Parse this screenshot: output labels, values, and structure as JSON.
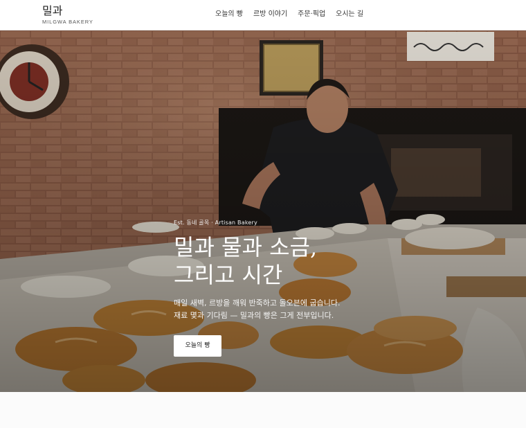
{
  "brand": {
    "title": "밀과",
    "subtitle": "MILGWA BAKERY"
  },
  "nav": {
    "items": [
      "오늘의 빵",
      "르방 이야기",
      "주문·픽업",
      "오시는 길"
    ]
  },
  "hero": {
    "eyebrow": "Est. 동네 골목 · Artisan Bakery",
    "title_line1": "밀과 물과 소금,",
    "title_line2": "그리고 시간",
    "desc_line1": "매일 새벽, 르방을 깨워 반죽하고 돌오븐에 굽습니다.",
    "desc_line2": "재료 몇과 기다림 — 밀과의 빵은 그게 전부입니다.",
    "cta_label": "오늘의 빵"
  },
  "colors": {
    "accent": "#ffffff",
    "text": "#222222",
    "header_bg": "#ffffff"
  }
}
